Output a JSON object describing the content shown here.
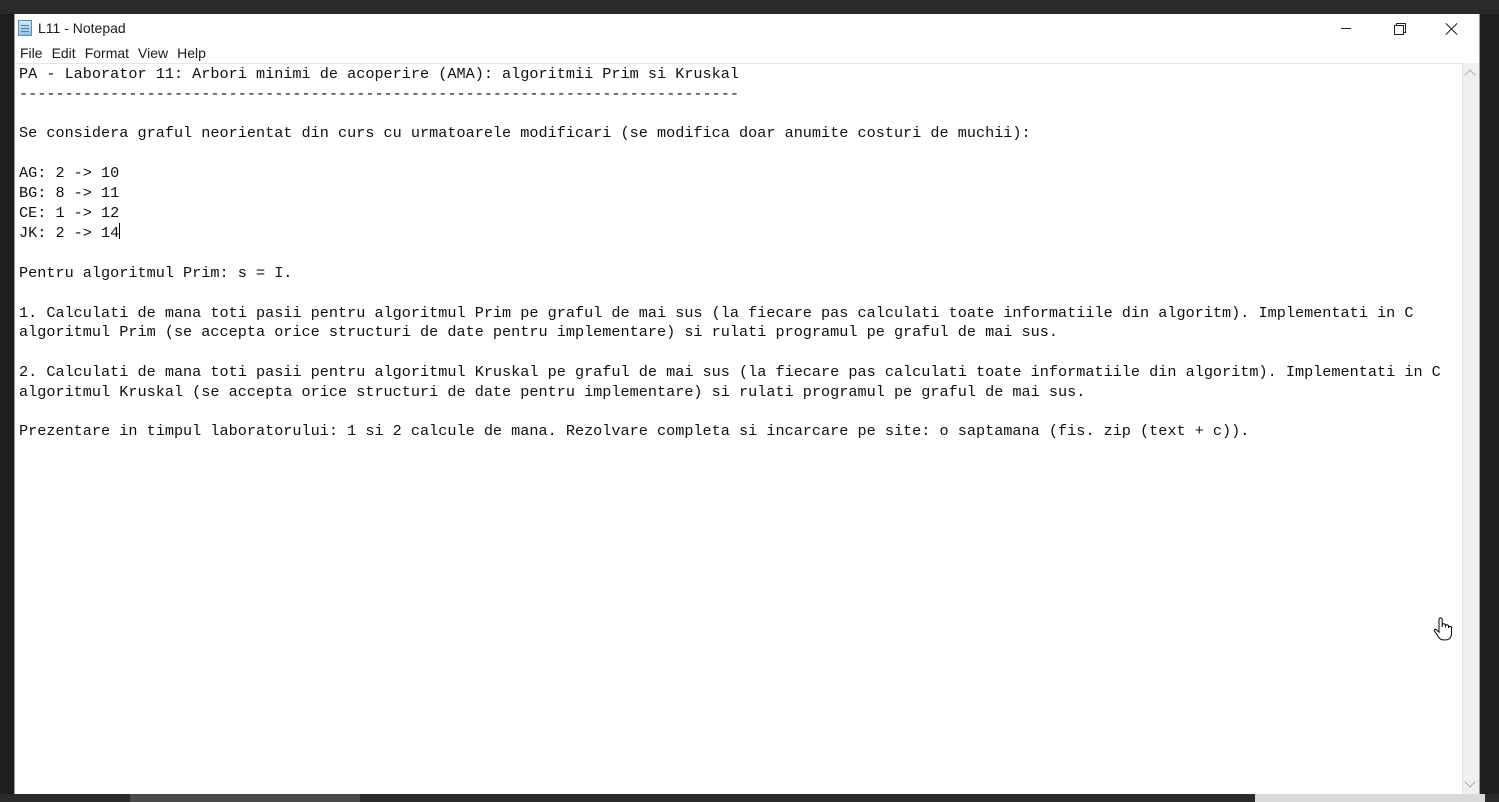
{
  "window": {
    "title": "L11 - Notepad"
  },
  "menu": [
    "File",
    "Edit",
    "Format",
    "View",
    "Help"
  ],
  "editor": {
    "lines": [
      "PA - Laborator 11: Arbori minimi de acoperire (AMA): algoritmii Prim si Kruskal",
      "-------------------------------------------------------------------------------",
      "",
      "Se considera graful neorientat din curs cu urmatoarele modificari (se modifica doar anumite costuri de muchii):",
      "",
      "AG: 2 -> 10",
      "BG: 8 -> 11",
      "CE: 1 -> 12",
      "JK: 2 -> 14",
      "",
      "Pentru algoritmul Prim: s = I.",
      "",
      "1. Calculati de mana toti pasii pentru algoritmul Prim pe graful de mai sus (la fiecare pas calculati toate informatiile din algoritm). Implementati in C",
      "algoritmul Prim (se accepta orice structuri de date pentru implementare) si rulati programul pe graful de mai sus.",
      "",
      "2. Calculati de mana toti pasii pentru algoritmul Kruskal pe graful de mai sus (la fiecare pas calculati toate informatiile din algoritm). Implementati in C",
      "algoritmul Kruskal (se accepta orice structuri de date pentru implementare) si rulati programul pe graful de mai sus.",
      "",
      "Prezentare in timpul laboratorului: 1 si 2 calcule de mana. Rezolvare completa si incarcare pe site: o saptamana (fis. zip (text + c))."
    ]
  },
  "icons": {
    "app": "notepad-icon",
    "minimize": "minimize-icon",
    "maximize": "restore-icon",
    "close": "close-icon",
    "pointer": "hand-cursor-icon"
  },
  "colors": {
    "background": "#ffffff",
    "text": "#101010",
    "scrollbar": "#f0f0f0"
  }
}
